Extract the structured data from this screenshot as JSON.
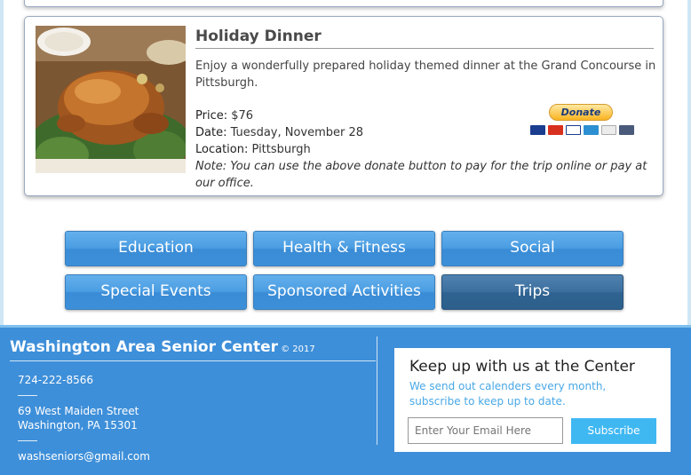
{
  "event": {
    "title": "Holiday Dinner",
    "description": "Enjoy a wonderfully prepared holiday themed dinner at the Grand Concourse in Pittsburgh.",
    "price_label": "Price:",
    "price": "$76",
    "date_label": "Date:",
    "date": "Tuesday, November 28",
    "location_label": "Location:",
    "location": "Pittsburgh",
    "note": "Note: You can use the above donate button to pay for the trip online or pay at our office.",
    "donate_label": "Donate"
  },
  "nav": {
    "items": [
      {
        "label": "Education"
      },
      {
        "label": "Health & Fitness"
      },
      {
        "label": "Social"
      },
      {
        "label": "Special Events"
      },
      {
        "label": "Sponsored Activities"
      },
      {
        "label": "Trips"
      }
    ],
    "active": "Trips"
  },
  "footer": {
    "org_name": "Washington Area Senior Center",
    "copyright": "© 2017",
    "phone": "724-222-8566",
    "address_line1": "69 West Maiden Street",
    "address_line2": "Washington, PA 15301",
    "email": "washseniors@gmail.com"
  },
  "subscribe": {
    "title": "Keep up with us at the Center",
    "text": "We send out calenders every month, subscribe to keep up to date.",
    "email_placeholder": "Enter Your Email Here",
    "button_label": "Subscribe"
  },
  "colors": {
    "footer_bg": "#3e8fd9",
    "nav_button": "#4b9de2",
    "nav_active": "#3c6f9e",
    "subscribe_button": "#3fb8f2",
    "donate": "#f9b421"
  },
  "icons": {
    "card_logos": [
      "maestro-icon",
      "mastercard-icon",
      "visa-icon",
      "amex-icon",
      "discover-icon",
      "bank-icon"
    ]
  }
}
